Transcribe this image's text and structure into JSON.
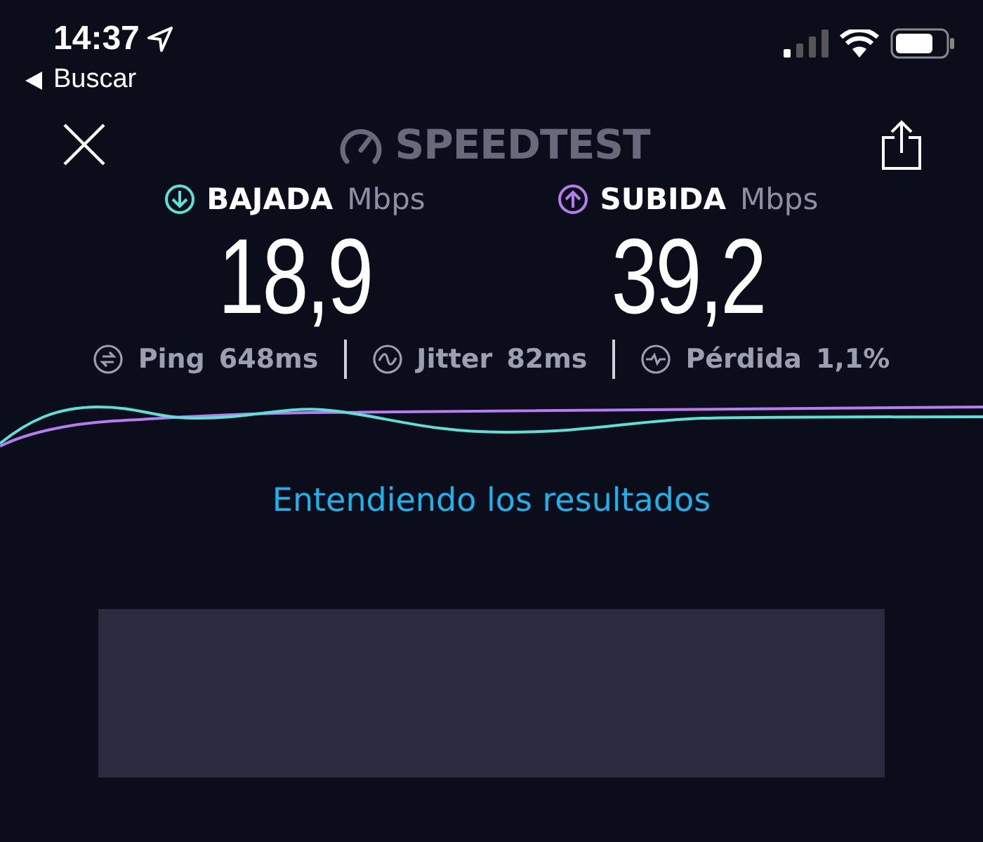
{
  "status_bar": {
    "time": "14:37",
    "back_label": "Buscar"
  },
  "header": {
    "logo_text": "SPEEDTEST"
  },
  "results": [
    {
      "kind": "download",
      "label": "BAJADA",
      "unit": "Mbps",
      "value": "18,9",
      "color": "#5ce1d6"
    },
    {
      "kind": "upload",
      "label": "SUBIDA",
      "unit": "Mbps",
      "value": "39,2",
      "color": "#b77cf0"
    }
  ],
  "stats": [
    {
      "kind": "ping",
      "label": "Ping",
      "value": "648ms"
    },
    {
      "kind": "jitter",
      "label": "Jitter",
      "value": "82ms"
    },
    {
      "kind": "loss",
      "label": "Pérdida",
      "value": "1,1%"
    }
  ],
  "link": "Entendiendo los resultados"
}
